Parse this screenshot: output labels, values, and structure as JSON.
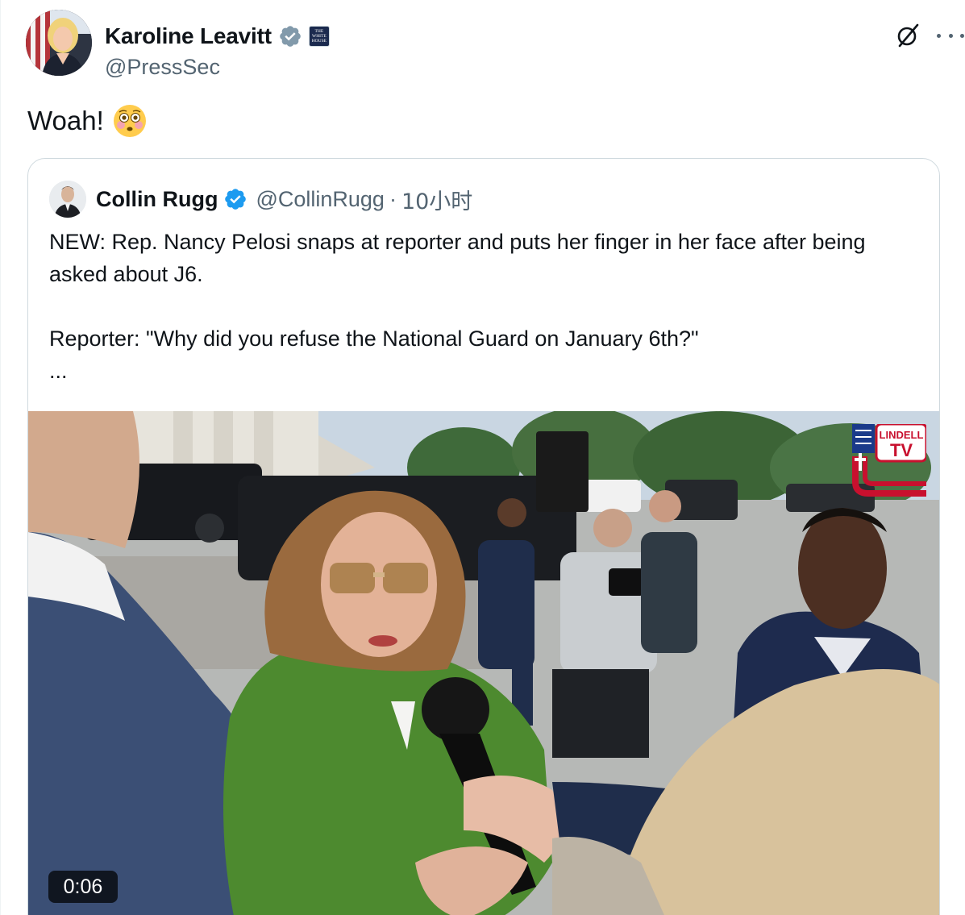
{
  "tweet": {
    "author": {
      "display_name": "Karoline Leavitt",
      "handle": "@PressSec",
      "affiliation_badge_text": "THE WHITE HOUSE",
      "verified_color": "#829aab"
    },
    "text": "Woah!",
    "emoji": "flushed-face",
    "actions": {
      "grok_icon": "slashed-circle-icon",
      "more_icon": "more-horizontal-icon"
    }
  },
  "quote": {
    "author": {
      "display_name": "Collin Rugg",
      "handle": "@CollinRugg",
      "separator": "·",
      "time": "10小时",
      "verified_color": "#1d9bf0"
    },
    "body": {
      "line1": "NEW: Rep. Nancy Pelosi snaps at reporter and puts her finger in her face after being asked about J6.",
      "line2": "Reporter: \"Why did you refuse the National Guard on January 6th?\"",
      "line3": "..."
    },
    "media": {
      "type": "video",
      "duration": "0:06",
      "watermark_line1": "LINDELL",
      "watermark_line2": "TV"
    }
  },
  "colors": {
    "text_primary": "#0f1419",
    "text_secondary": "#536471",
    "border": "#cfd9de",
    "verified_blue": "#1d9bf0"
  }
}
